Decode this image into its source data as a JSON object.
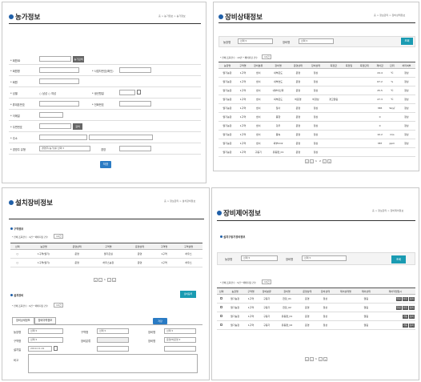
{
  "q1": {
    "title": "농가정보",
    "breadcrumb": "홈 > 농가정보 > 농가정보",
    "search_btn": "농가검색",
    "labels": [
      "* 회원ID",
      "* 회원명",
      "* 사업자번호(확인)",
      "* 회원",
      "* 성별",
      "* 생년월일",
      "* 휴대폰번호",
      "* 전화번호",
      "* 이메일",
      "* 우편번호",
      "* 주소",
      "* 경영주 유형",
      "경영"
    ],
    "radio_male": "남성",
    "radio_female": "여성",
    "zip_btn": "검색",
    "type_value": "경영주(농가)를 선택",
    "save_btn": "저장"
  },
  "q2": {
    "title": "장비상태정보",
    "breadcrumb": "홈 > 정보관리 > 장비상태정보",
    "filter_labels": [
      "농장명",
      "장비명"
    ],
    "filter_values": [
      "선택",
      "선택"
    ],
    "search_btn": "조회",
    "count_text": "* 전체 조회건수 : 13건  * 페이지당 건수",
    "page_size": "10건",
    "columns": [
      "농장명",
      "구역명",
      "장비분류",
      "장비명",
      "운영상태",
      "장비상태",
      "측정값",
      "측정일",
      "측정단위",
      "제어값",
      "단위",
      "처리여부"
    ],
    "rows": [
      [
        "딸기농장",
        "1구역",
        "센서",
        "내부온도",
        "운영",
        "정상",
        "",
        "",
        "",
        "24.4",
        "℃",
        "정상"
      ],
      [
        "딸기농장",
        "1구역",
        "센서",
        "내부습도",
        "운영",
        "정상",
        "",
        "",
        "",
        "67.2",
        "%",
        "정상"
      ],
      [
        "딸기농장",
        "1구역",
        "센서",
        "내부이산화",
        "운영",
        "정상",
        "",
        "",
        "",
        "25.5",
        "℃",
        "정상"
      ],
      [
        "딸기농장",
        "1구역",
        "센서",
        "외부온도",
        "비운영",
        "비정상",
        "경고알림",
        "",
        "",
        "27.3",
        "℃",
        "정상"
      ],
      [
        "딸기농장",
        "1구역",
        "센서",
        "일사",
        "운영",
        "정상",
        "",
        "",
        "",
        "365",
        "W/㎡",
        "정상"
      ],
      [
        "딸기농장",
        "1구역",
        "센서",
        "풍향",
        "운영",
        "정상",
        "",
        "",
        "",
        "0",
        "",
        "정상"
      ],
      [
        "딸기농장",
        "1구역",
        "센서",
        "강우",
        "운영",
        "정상",
        "",
        "",
        "",
        "0",
        "",
        "정상"
      ],
      [
        "딸기농장",
        "1구역",
        "센서",
        "풍속",
        "운영",
        "정상",
        "",
        "",
        "",
        "10.2",
        "m/s",
        "정상"
      ],
      [
        "딸기농장",
        "1구역",
        "센서",
        "외부CO2",
        "운영",
        "정상",
        "",
        "",
        "",
        "387",
        "ppm",
        "정상"
      ],
      [
        "딸기농장",
        "1구역",
        "구동기",
        "유동팬_01",
        "운영",
        "정상",
        "",
        "",
        "",
        "",
        "",
        ""
      ]
    ],
    "pages": [
      "1",
      "2"
    ]
  },
  "q3": {
    "title": "설치장비정보",
    "breadcrumb": "홈 > 정보관리 > 설치장비정보",
    "section1": "구역정보",
    "count_text1": "* 전체 조회건수 : 2건  * 페이지당 건수",
    "page_size1": "10건",
    "zone_columns": [
      "선택",
      "농장명",
      "운영상태",
      "구역명",
      "운영상태",
      "구역명",
      "구역설명"
    ],
    "zone_rows": [
      [
        "",
        "1구역(딸기)",
        "운영",
        "딸기온실",
        "운영",
        "1구역",
        "하우스"
      ],
      [
        "",
        "1구역(딸기)",
        "운영",
        "하우스농장",
        "운영",
        "1구역",
        "하우스"
      ]
    ],
    "section2": "설치장비",
    "add_btn": "장비등록",
    "count_text2": "* 전체 조회건수 : 0건  * 페이지당 건수",
    "page_size2": "10건",
    "tabs": [
      "장비상세정보",
      "장비이력정보"
    ],
    "save_btn": "저장",
    "form_labels": [
      "농장명",
      "구역명",
      "장비명",
      "구역명",
      "장비분류",
      "장비명",
      "설치일",
      "비고"
    ],
    "form_values": [
      "선택",
      "선택",
      "선택",
      "선택",
      "",
      "운영/비운영",
      "2019-11-01",
      ""
    ],
    "pages": [
      "1"
    ]
  },
  "q4": {
    "title": "장비제어정보",
    "breadcrumb": "홈 > 정보관리 > 장비제어정보",
    "subtitle": "설치구동기장비정보",
    "filter_labels": [
      "농장명",
      "장비명"
    ],
    "filter_values": [
      "선택",
      "선택"
    ],
    "search_btn": "조회",
    "count_text": "* 전체 조회건수 : 5건  * 페이지당 건수",
    "page_size": "10건",
    "columns": [
      "선택",
      "농장명",
      "구역명",
      "장비분류",
      "장비명",
      "운영상태",
      "장비상태",
      "제어상태명",
      "제어상태",
      "제어작업일시"
    ],
    "rows": [
      [
        "딸기농장",
        "1구역",
        "구동기",
        "천장_01",
        "운영",
        "정상",
        "",
        "열림",
        "2019-09-27 09:00:00",
        [
          "열림",
          "닫힘",
          "정지"
        ]
      ],
      [
        "딸기농장",
        "1구역",
        "구동기",
        "천장_02",
        "운영",
        "정상",
        "",
        "열림",
        "2019-09-27 09:00:00",
        [
          "열림",
          "닫힘",
          "정지"
        ]
      ],
      [
        "딸기농장",
        "1구역",
        "구동기",
        "유동팬_01",
        "운영",
        "정상",
        "",
        "열림",
        "2019-09-27 09:00:00",
        [
          "가동",
          "정지"
        ]
      ],
      [
        "딸기농장",
        "1구역",
        "구동기",
        "유동팬_02",
        "운영",
        "정상",
        "",
        "열림",
        "2019-09-27 09:00:00",
        [
          "가동",
          "정지"
        ]
      ]
    ],
    "pages": [
      "1"
    ]
  },
  "colors": {
    "accent": "#2a7bc4",
    "teal": "#1a9bb2",
    "dot": "#1f5fa8"
  }
}
